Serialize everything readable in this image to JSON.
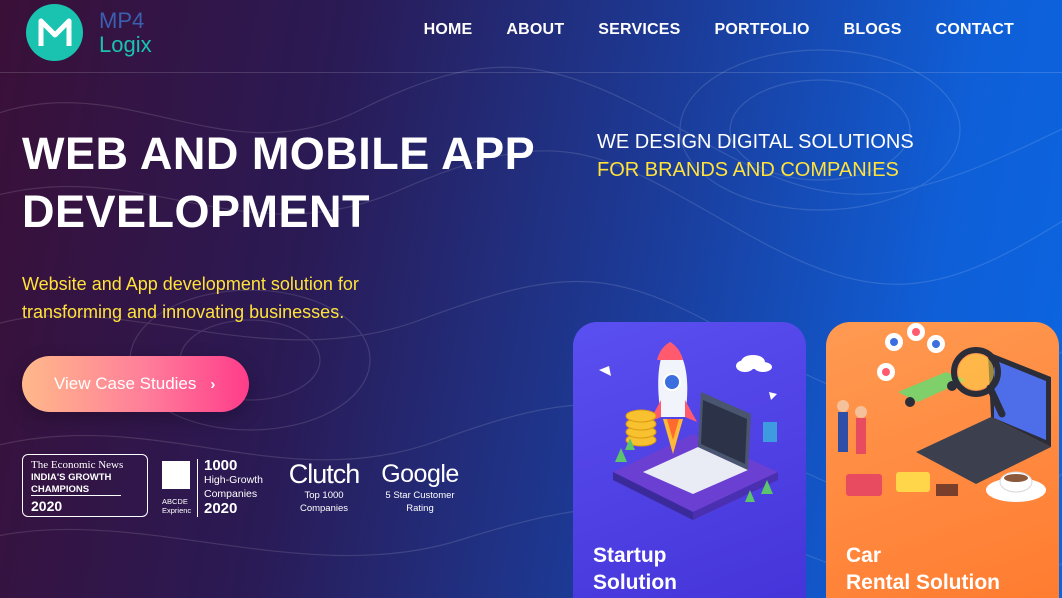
{
  "brand": {
    "name_line1": "MP4",
    "name_line2": "Logix",
    "mark": "M",
    "color": "#19c3b0"
  },
  "nav": [
    {
      "label": "HOME"
    },
    {
      "label": "ABOUT"
    },
    {
      "label": "SERVICES"
    },
    {
      "label": "PORTFOLIO"
    },
    {
      "label": "BLOGS"
    },
    {
      "label": "CONTACT"
    }
  ],
  "hero": {
    "title_line1": "WEB AND MOBILE APP",
    "title_line2": "DEVELOPMENT",
    "subtitle": "Website and App development solution for transforming and innovating businesses.",
    "cta_label": "View Case Studies",
    "cta_icon": "chevron-right-icon"
  },
  "badges": {
    "economic": {
      "source": "The Economic News",
      "line1": "INDIA'S GROWTH",
      "line2": "CHAMPIONS",
      "year": "2020"
    },
    "inc1000": {
      "abbr_line1": "ABCDE",
      "abbr_line2": "Exprienc",
      "number": "1000",
      "desc_line1": "High-Growth",
      "desc_line2": "Companies",
      "year": "2020"
    },
    "clutch": {
      "name": "Clutch",
      "line1": "Top 1000",
      "line2": "Companies"
    },
    "google": {
      "name": "Google",
      "line1": "5 Star Customer",
      "line2": "Rating"
    }
  },
  "tagline": {
    "line1": "WE DESIGN DIGITAL SOLUTIONS",
    "line2": "FOR BRANDS AND COMPANIES"
  },
  "cards": [
    {
      "title_line1": "Startup",
      "title_line2": "Solution",
      "color": "#4a3fe6"
    },
    {
      "title_line1": "Car",
      "title_line2": "Rental Solution",
      "color": "#ff8a3d"
    }
  ],
  "colors": {
    "accent_yellow": "#ffe23a",
    "cta_pink": "#ff3c8a",
    "cta_peach": "#ffb98a"
  }
}
